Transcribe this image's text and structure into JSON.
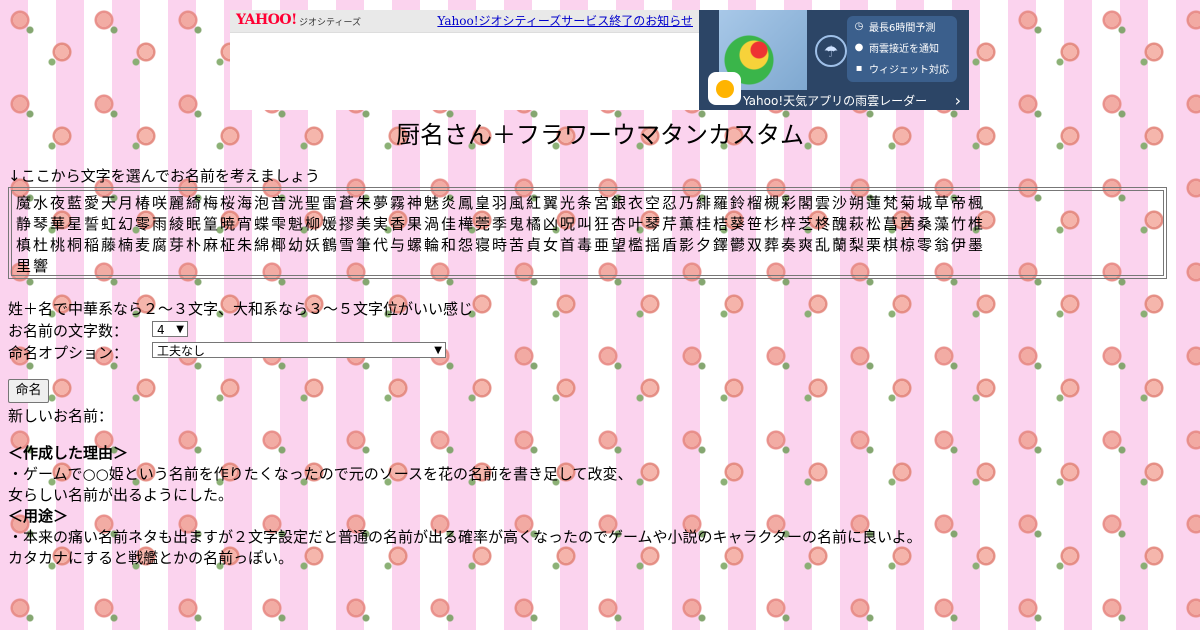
{
  "ad": {
    "logo": "YAHOO!",
    "logo_sub": "ジオシティーズ",
    "notice_link": "Yahoo!ジオシティーズサービス終了のお知らせ"
  },
  "weather_ad": {
    "features": [
      {
        "icon": "clock-icon",
        "label": "最長6時間予測"
      },
      {
        "icon": "location-pin-icon",
        "label": "雨雲接近を通知"
      },
      {
        "icon": "widget-grid-icon",
        "label": "ウィジェット対応"
      }
    ],
    "footer": "Yahoo!天気アプリの雨雲レーダー",
    "footer_arrow": "›"
  },
  "page": {
    "title": "厨名さん＋フラワーウマタンカスタム",
    "hint": "↓ここから文字を選んでお名前を考えましょう",
    "chars_line1": "魔水夜藍愛天月椿咲麗綺梅桜海泡音洸聖雷蒼朱夢霧神魅炎鳳皇羽風紅翼光条宮銀衣空忍乃緋羅鈴榴槻彩閣雲沙朔蓮梵菊城草帝楓",
    "chars_line2": "静琴華星誓虹幻零雨綾眠篁暁宵蝶雫魁柳媛摎美実香果渦佳樺莞季鬼橘凶呪叫狂杏叶琴芹薫桂桔葵笹杉梓芝柊醜萩松菖茜桑藻竹椎",
    "chars_line3": "槙杜桃桐稲藤楠麦腐芽朴麻柾朱綿椰幼妖鶴雪筆代与螺輪和怨寝時苦貞女首毒亜望檻揺盾影夕鐸鬱双葬奏爽乱蘭梨栗棋椋零翁伊墨",
    "chars_line4": "里響",
    "description": "姓＋名で中華系なら２～３文字、大和系なら３～５文字位がいい感じ",
    "length_label": "お名前の文字数：",
    "length_value": "4",
    "option_label": "命名オプション：",
    "option_value": "工夫なし",
    "name_button": "命名",
    "result_label": "新しいお名前："
  },
  "reason": {
    "heading": "＜作成した理由＞",
    "line1": "・ゲームで○○姫という名前を作りたくなったので元のソースを花の名前を書き足して改変、",
    "line2": "女らしい名前が出るようにした。"
  },
  "usage": {
    "heading": "＜用途＞",
    "line1": "・本来の痛い名前ネタも出ますが２文字設定だと普通の名前が出る確率が高くなったのでゲームや小説のキャラクターの名前に良いよ。",
    "line2": "カタカナにすると戦艦とかの名前っぽい。"
  }
}
